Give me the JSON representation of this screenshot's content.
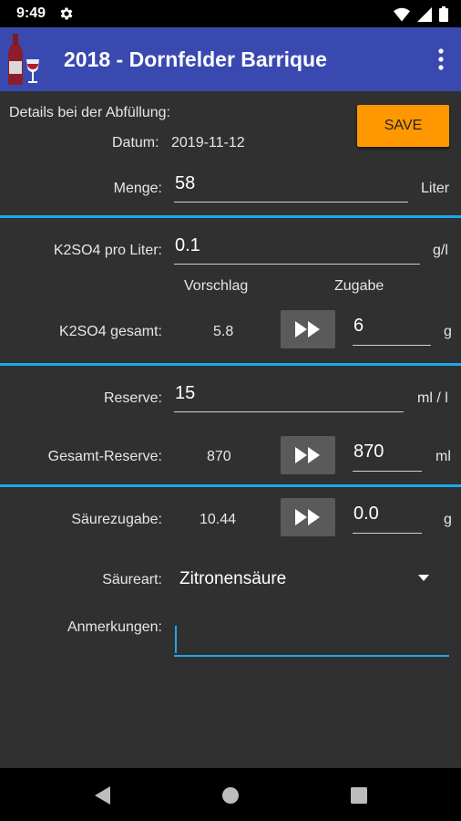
{
  "status": {
    "time": "9:49"
  },
  "header": {
    "title": "2018 - Dornfelder Barrique"
  },
  "form": {
    "details_label": "Details bei der Abfüllung:",
    "save_label": "SAVE",
    "datum_label": "Datum:",
    "datum_value": "2019-11-12",
    "menge_label": "Menge:",
    "menge_value": "58",
    "menge_unit": "Liter",
    "k2so4_per_liter_label": "K2SO4 pro Liter:",
    "k2so4_per_liter_value": "0.1",
    "k2so4_per_liter_unit": "g/l",
    "vorschlag_header": "Vorschlag",
    "zugabe_header": "Zugabe",
    "k2so4_total_label": "K2SO4 gesamt:",
    "k2so4_total_suggestion": "5.8",
    "k2so4_total_value": "6",
    "k2so4_total_unit": "g",
    "reserve_label": "Reserve:",
    "reserve_value": "15",
    "reserve_unit": "ml / l",
    "gesamt_reserve_label": "Gesamt-Reserve:",
    "gesamt_reserve_suggestion": "870",
    "gesamt_reserve_value": "870",
    "gesamt_reserve_unit": "ml",
    "saeurezugabe_label": "Säurezugabe:",
    "saeurezugabe_suggestion": "10.44",
    "saeurezugabe_value": "0.0",
    "saeurezugabe_unit": "g",
    "saeureart_label": "Säureart:",
    "saeureart_value": "Zitronensäure",
    "anmerkungen_label": "Anmerkungen:",
    "anmerkungen_value": ""
  },
  "colors": {
    "app_bar": "#3949b0",
    "accent": "#1aa8e8",
    "save_button": "#ff9800",
    "background": "#303030"
  },
  "icons": [
    "settings-gear-icon",
    "wifi-icon",
    "cell-signal-icon",
    "battery-icon",
    "wine-bottle-logo-icon",
    "overflow-menu-icon",
    "fast-forward-icon",
    "dropdown-arrow-icon",
    "nav-back-icon",
    "nav-home-icon",
    "nav-recents-icon"
  ]
}
